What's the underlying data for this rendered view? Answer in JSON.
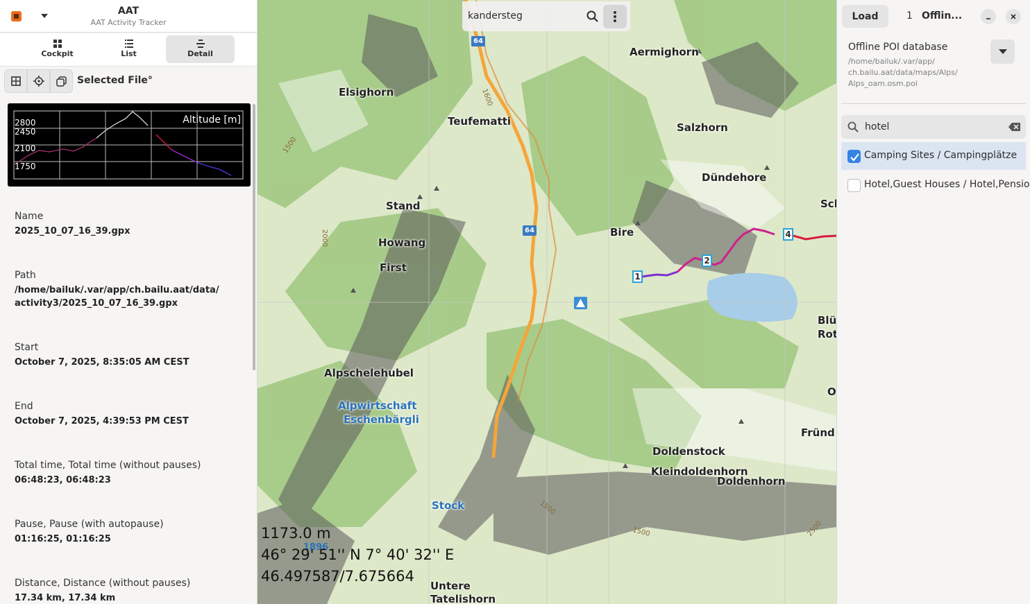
{
  "app": {
    "title": "AAT",
    "subtitle": "AAT Activity Tracker"
  },
  "views": {
    "cockpit": "Cockpit",
    "list": "List",
    "detail": "Detail",
    "active": "detail"
  },
  "toolbar": {
    "selected_label": "Selected File°"
  },
  "graph": {
    "label": "Altitude [m]",
    "ticks": [
      "2800",
      "2450",
      "2100",
      "1750"
    ]
  },
  "details": [
    {
      "key": "Name",
      "value": "2025_10_07_16_39.gpx"
    },
    {
      "key": "Path",
      "value": "/home/bailuk/.var/app/ch.bailu.aat/data/\nactivity3/2025_10_07_16_39.gpx"
    },
    {
      "key": "Start",
      "value": "October 7, 2025, 8:35:05 AM CEST"
    },
    {
      "key": "End",
      "value": "October 7, 2025, 4:39:53 PM CEST"
    },
    {
      "key": "Total time, Total time (without pauses)",
      "value": "06:48:23, 06:48:23"
    },
    {
      "key": "Pause, Pause (with autopause)",
      "value": "01:16:25, 01:16:25"
    },
    {
      "key": "Distance, Distance (without pauses)",
      "value": "17.34 km, 17.34 km"
    }
  ],
  "map": {
    "search_value": "kandersteg",
    "altitude": "1173.0 m",
    "dms": "46° 29' 51'' N 7° 40' 32'' E",
    "decimal": "46.497587/7.675664",
    "labels": {
      "aermighorn": "Aermighorn",
      "elsighorn": "Elsighorn",
      "teufematti": "Teufematti",
      "salzhorn": "Salzhorn",
      "dundehore": "Dündehore",
      "stand": "Stand",
      "howang": "Howang",
      "first": "First",
      "bire": "Bire",
      "sch": "Sch",
      "blu": "Blü",
      "rot": "Rot",
      "alpschelehubel": "Alpschelehubel",
      "alpwirtschaft": "Alpwirtschaft",
      "eschenbargli": "Eschenbärgli",
      "o": "O",
      "frund": "Fründ",
      "doldenstock": "Doldenstock",
      "kleindoldenhorn": "Kleindoldenhorn",
      "doldenhorn": "Doldenhorn",
      "stock": "Stock",
      "untere": "Untere",
      "tatelishorn": "Tatelishorn",
      "route_64a": "64",
      "route_64b": "64",
      "wp1": "1",
      "wp2": "2",
      "wp4": "4",
      "contour_1500a": "1500",
      "contour_2000": "2000",
      "contour_1600": "1600",
      "contour_1500b": "1500",
      "contour_1500c": "1500",
      "contour_2500": "2500",
      "elev_1896": "1896"
    },
    "colors": {
      "road": "#f5a53a",
      "track_start": "#7b2fd1",
      "track_mid": "#d01f8c",
      "track_end": "#d81b3c",
      "lake": "#a8cde8"
    }
  },
  "poi": {
    "load": "Load",
    "count": "1",
    "title": "Offlin...",
    "db_title": "Offline POI database",
    "db_path": "/home/bailuk/.var/app/\nch.bailu.aat/data/maps/Alps/\nAlps_oam.osm.poi",
    "search_value": "hotel",
    "categories": [
      {
        "label": "Camping Sites / Campingplätze",
        "checked": true
      },
      {
        "label": "Hotel,Guest Houses / Hotel,Pension",
        "checked": false
      }
    ]
  }
}
